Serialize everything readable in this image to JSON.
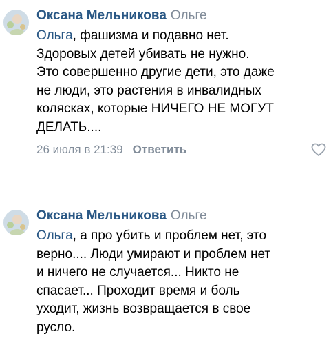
{
  "comments": [
    {
      "author": "Оксана Мельникова",
      "reply_to": "Ольге",
      "mention": "Ольга",
      "text_line1": ", фашизма и подавно нет.",
      "text_rest": [
        "Здоровых детей убивать не нужно.",
        "Это совершенно другие дети, это даже",
        "не люди, это растения в инвалидных",
        "колясках, которые НИЧЕГО НЕ МОГУТ",
        "ДЕЛАТЬ...."
      ],
      "date": "26 июля в 21:39",
      "reply_label": "Ответить",
      "like_icon": "heart-outline-icon"
    },
    {
      "author": "Оксана Мельникова",
      "reply_to": "Ольге",
      "mention": "Ольга",
      "text_line1": ", а про убить и проблем нет, это",
      "text_rest": [
        "верно.... Люди умирают и проблем нет",
        "и ничего не случается... Никто не",
        "спасает... Проходит время и боль",
        "уходит, жизнь возвращается в свое",
        "русло."
      ]
    }
  ],
  "colors": {
    "link": "#2a5885",
    "secondary": "#818c99",
    "text": "#000000"
  }
}
